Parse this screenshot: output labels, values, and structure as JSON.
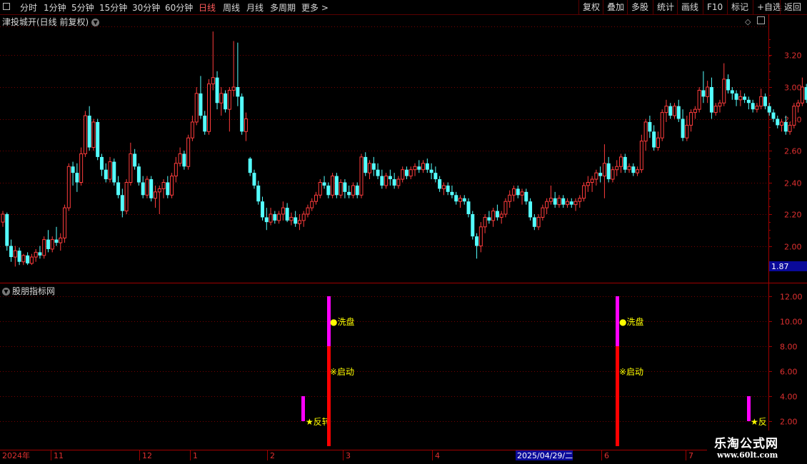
{
  "toolbar": {
    "periods": [
      "分时",
      "1分钟",
      "5分钟",
      "15分钟",
      "30分钟",
      "60分钟",
      "日线",
      "周线",
      "月线",
      "多周期",
      "更多 >"
    ],
    "active_period": "日线",
    "right_buttons": [
      "复权",
      "叠加",
      "多股",
      "统计",
      "画线",
      "F10",
      "标记",
      "+自选",
      "返回"
    ]
  },
  "stock": {
    "title": "津投城开(日线 前复权)",
    "chevron_icon": "chevron-down-icon"
  },
  "price_axis": {
    "ticks": [
      "3.20",
      "3.00",
      "2.80",
      "2.60",
      "2.40",
      "2.20",
      "2.00"
    ],
    "current_price": "1.87"
  },
  "indicator": {
    "title": "股朋指标网",
    "axis_ticks": [
      "12.00",
      "10.00",
      "8.00",
      "6.00",
      "4.00",
      "2.00"
    ],
    "signals": {
      "reversal": "★反转",
      "wash": "●洗盘",
      "start": "※启动",
      "reversal_cut": "★反"
    }
  },
  "time_axis": {
    "labels": [
      "2024年",
      "11",
      "12",
      "1",
      "2",
      "3",
      "4",
      "2025/04/29/二",
      "6",
      "7"
    ]
  },
  "watermark": {
    "line1": "乐淘公式网",
    "line2": "www.60lt.com"
  },
  "colors": {
    "up": "#ff3c3c",
    "down": "#54ffff",
    "grid": "#7a0000",
    "axis": "#a00000",
    "magenta": "#ff00ff",
    "red": "#ff0000",
    "signal": "#ffff00",
    "current_bg": "#0a0a9a"
  },
  "chart_data": {
    "type": "candlestick",
    "price_range": [
      1.87,
      3.35
    ],
    "candles": [
      [
        2.15,
        2.22,
        2.12,
        2.2
      ],
      [
        2.2,
        2.21,
        1.97,
        2.0
      ],
      [
        2.0,
        2.04,
        1.9,
        1.93
      ],
      [
        1.93,
        2.0,
        1.87,
        1.97
      ],
      [
        1.97,
        1.99,
        1.88,
        1.9
      ],
      [
        1.9,
        1.95,
        1.88,
        1.94
      ],
      [
        1.94,
        1.96,
        1.88,
        1.89
      ],
      [
        1.89,
        1.95,
        1.88,
        1.93
      ],
      [
        1.93,
        1.98,
        1.9,
        1.96
      ],
      [
        1.96,
        2.0,
        1.92,
        1.94
      ],
      [
        1.94,
        2.06,
        1.92,
        2.04
      ],
      [
        2.04,
        2.1,
        1.96,
        1.98
      ],
      [
        1.98,
        2.06,
        1.96,
        2.04
      ],
      [
        2.04,
        2.12,
        2.0,
        2.02
      ],
      [
        2.02,
        2.08,
        1.97,
        2.05
      ],
      [
        2.05,
        2.26,
        2.02,
        2.24
      ],
      [
        2.24,
        2.52,
        2.22,
        2.5
      ],
      [
        2.5,
        2.53,
        2.38,
        2.46
      ],
      [
        2.46,
        2.52,
        2.34,
        2.4
      ],
      [
        2.4,
        2.62,
        2.38,
        2.58
      ],
      [
        2.58,
        2.85,
        2.56,
        2.82
      ],
      [
        2.82,
        2.88,
        2.6,
        2.62
      ],
      [
        2.62,
        2.8,
        2.6,
        2.78
      ],
      [
        2.78,
        2.8,
        2.54,
        2.56
      ],
      [
        2.56,
        2.58,
        2.44,
        2.48
      ],
      [
        2.48,
        2.52,
        2.4,
        2.42
      ],
      [
        2.42,
        2.56,
        2.4,
        2.53
      ],
      [
        2.53,
        2.55,
        2.38,
        2.4
      ],
      [
        2.4,
        2.44,
        2.3,
        2.32
      ],
      [
        2.32,
        2.36,
        2.18,
        2.22
      ],
      [
        2.22,
        2.42,
        2.2,
        2.4
      ],
      [
        2.4,
        2.65,
        2.38,
        2.58
      ],
      [
        2.58,
        2.61,
        2.48,
        2.5
      ],
      [
        2.5,
        2.52,
        2.38,
        2.4
      ],
      [
        2.4,
        2.44,
        2.3,
        2.32
      ],
      [
        2.32,
        2.44,
        2.3,
        2.42
      ],
      [
        2.42,
        2.44,
        2.28,
        2.3
      ],
      [
        2.3,
        2.38,
        2.24,
        2.34
      ],
      [
        2.34,
        2.38,
        2.2,
        2.36
      ],
      [
        2.36,
        2.42,
        2.3,
        2.4
      ],
      [
        2.4,
        2.44,
        2.3,
        2.32
      ],
      [
        2.32,
        2.46,
        2.3,
        2.44
      ],
      [
        2.44,
        2.56,
        2.4,
        2.52
      ],
      [
        2.52,
        2.62,
        2.5,
        2.58
      ],
      [
        2.58,
        2.6,
        2.48,
        2.5
      ],
      [
        2.5,
        2.7,
        2.48,
        2.68
      ],
      [
        2.68,
        2.82,
        2.66,
        2.78
      ],
      [
        2.78,
        3.0,
        2.76,
        2.96
      ],
      [
        2.96,
        3.07,
        2.8,
        2.82
      ],
      [
        2.82,
        2.85,
        2.7,
        2.72
      ],
      [
        2.72,
        3.05,
        2.7,
        3.02
      ],
      [
        3.02,
        3.35,
        2.98,
        3.06
      ],
      [
        3.06,
        3.1,
        2.86,
        2.9
      ],
      [
        2.9,
        3.0,
        2.82,
        2.96
      ],
      [
        2.96,
        2.98,
        2.84,
        2.86
      ],
      [
        2.86,
        3.0,
        2.72,
        2.98
      ],
      [
        2.98,
        3.29,
        2.94,
        3.0
      ],
      [
        3.0,
        3.28,
        2.88,
        2.94
      ],
      [
        2.94,
        2.96,
        2.7,
        2.72
      ],
      [
        2.72,
        2.84,
        2.66,
        2.8
      ],
      [
        2.55,
        2.56,
        2.44,
        2.46
      ],
      [
        2.46,
        2.48,
        2.36,
        2.38
      ],
      [
        2.38,
        2.41,
        2.26,
        2.28
      ],
      [
        2.28,
        2.31,
        2.16,
        2.18
      ],
      [
        2.18,
        2.24,
        2.1,
        2.15
      ],
      [
        2.15,
        2.24,
        2.13,
        2.2
      ],
      [
        2.2,
        2.22,
        2.14,
        2.16
      ],
      [
        2.16,
        2.22,
        2.14,
        2.2
      ],
      [
        2.2,
        2.28,
        2.16,
        2.24
      ],
      [
        2.24,
        2.27,
        2.15,
        2.16
      ],
      [
        2.16,
        2.21,
        2.13,
        2.18
      ],
      [
        2.18,
        2.22,
        2.12,
        2.14
      ],
      [
        2.14,
        2.2,
        2.1,
        2.16
      ],
      [
        2.16,
        2.22,
        2.12,
        2.2
      ],
      [
        2.2,
        2.26,
        2.18,
        2.24
      ],
      [
        2.24,
        2.3,
        2.22,
        2.28
      ],
      [
        2.28,
        2.34,
        2.26,
        2.32
      ],
      [
        2.32,
        2.42,
        2.3,
        2.4
      ],
      [
        2.4,
        2.44,
        2.36,
        2.38
      ],
      [
        2.38,
        2.4,
        2.3,
        2.32
      ],
      [
        2.32,
        2.46,
        2.3,
        2.44
      ],
      [
        2.44,
        2.46,
        2.3,
        2.32
      ],
      [
        2.32,
        2.42,
        2.3,
        2.4
      ],
      [
        2.4,
        2.42,
        2.3,
        2.34
      ],
      [
        2.34,
        2.38,
        2.3,
        2.32
      ],
      [
        2.32,
        2.4,
        2.3,
        2.38
      ],
      [
        2.38,
        2.4,
        2.3,
        2.32
      ],
      [
        2.32,
        2.58,
        2.3,
        2.56
      ],
      [
        2.56,
        2.59,
        2.44,
        2.46
      ],
      [
        2.46,
        2.54,
        2.42,
        2.52
      ],
      [
        2.52,
        2.56,
        2.44,
        2.48
      ],
      [
        2.48,
        2.52,
        2.42,
        2.44
      ],
      [
        2.44,
        2.48,
        2.36,
        2.38
      ],
      [
        2.38,
        2.46,
        2.36,
        2.44
      ],
      [
        2.44,
        2.48,
        2.38,
        2.42
      ],
      [
        2.42,
        2.46,
        2.36,
        2.38
      ],
      [
        2.38,
        2.44,
        2.36,
        2.42
      ],
      [
        2.42,
        2.5,
        2.4,
        2.48
      ],
      [
        2.48,
        2.5,
        2.42,
        2.44
      ],
      [
        2.44,
        2.5,
        2.42,
        2.48
      ],
      [
        2.48,
        2.52,
        2.44,
        2.5
      ],
      [
        2.5,
        2.54,
        2.46,
        2.48
      ],
      [
        2.48,
        2.54,
        2.46,
        2.52
      ],
      [
        2.52,
        2.55,
        2.46,
        2.48
      ],
      [
        2.48,
        2.52,
        2.42,
        2.46
      ],
      [
        2.46,
        2.5,
        2.4,
        2.42
      ],
      [
        2.42,
        2.44,
        2.34,
        2.36
      ],
      [
        2.36,
        2.4,
        2.32,
        2.38
      ],
      [
        2.38,
        2.4,
        2.32,
        2.34
      ],
      [
        2.34,
        2.38,
        2.3,
        2.32
      ],
      [
        2.32,
        2.34,
        2.26,
        2.28
      ],
      [
        2.28,
        2.32,
        2.24,
        2.3
      ],
      [
        2.3,
        2.32,
        2.26,
        2.28
      ],
      [
        2.28,
        2.3,
        2.18,
        2.2
      ],
      [
        2.2,
        2.22,
        2.04,
        2.06
      ],
      [
        2.06,
        2.08,
        1.92,
        2.0
      ],
      [
        2.0,
        2.15,
        1.96,
        2.12
      ],
      [
        2.12,
        2.2,
        2.08,
        2.18
      ],
      [
        2.18,
        2.22,
        2.14,
        2.16
      ],
      [
        2.16,
        2.24,
        2.12,
        2.22
      ],
      [
        2.22,
        2.26,
        2.16,
        2.18
      ],
      [
        2.18,
        2.22,
        2.14,
        2.2
      ],
      [
        2.2,
        2.3,
        2.18,
        2.28
      ],
      [
        2.28,
        2.35,
        2.24,
        2.32
      ],
      [
        2.32,
        2.38,
        2.28,
        2.36
      ],
      [
        2.36,
        2.38,
        2.3,
        2.32
      ],
      [
        2.32,
        2.36,
        2.26,
        2.34
      ],
      [
        2.34,
        2.36,
        2.26,
        2.28
      ],
      [
        2.28,
        2.3,
        2.16,
        2.18
      ],
      [
        2.18,
        2.2,
        2.1,
        2.12
      ],
      [
        2.12,
        2.2,
        2.1,
        2.18
      ],
      [
        2.18,
        2.26,
        2.16,
        2.24
      ],
      [
        2.24,
        2.3,
        2.2,
        2.28
      ],
      [
        2.28,
        2.38,
        2.26,
        2.3
      ],
      [
        2.3,
        2.34,
        2.24,
        2.26
      ],
      [
        2.26,
        2.32,
        2.24,
        2.3
      ],
      [
        2.3,
        2.32,
        2.24,
        2.26
      ],
      [
        2.26,
        2.3,
        2.24,
        2.28
      ],
      [
        2.28,
        2.3,
        2.24,
        2.26
      ],
      [
        2.26,
        2.3,
        2.22,
        2.28
      ],
      [
        2.28,
        2.32,
        2.24,
        2.3
      ],
      [
        2.3,
        2.4,
        2.28,
        2.38
      ],
      [
        2.38,
        2.44,
        2.34,
        2.4
      ],
      [
        2.4,
        2.44,
        2.34,
        2.42
      ],
      [
        2.42,
        2.48,
        2.38,
        2.46
      ],
      [
        2.46,
        2.5,
        2.4,
        2.44
      ],
      [
        2.44,
        2.64,
        2.3,
        2.52
      ],
      [
        2.52,
        2.56,
        2.4,
        2.42
      ],
      [
        2.42,
        2.5,
        2.4,
        2.48
      ],
      [
        2.48,
        2.54,
        2.44,
        2.5
      ],
      [
        2.5,
        2.58,
        2.46,
        2.56
      ],
      [
        2.56,
        2.58,
        2.46,
        2.48
      ],
      [
        2.48,
        2.52,
        2.46,
        2.5
      ],
      [
        2.5,
        2.52,
        2.44,
        2.46
      ],
      [
        2.46,
        2.5,
        2.44,
        2.48
      ],
      [
        2.48,
        2.7,
        2.46,
        2.66
      ],
      [
        2.66,
        2.8,
        2.6,
        2.78
      ],
      [
        2.78,
        2.82,
        2.68,
        2.72
      ],
      [
        2.72,
        2.76,
        2.6,
        2.62
      ],
      [
        2.62,
        2.72,
        2.6,
        2.68
      ],
      [
        2.68,
        2.86,
        2.66,
        2.84
      ],
      [
        2.84,
        2.92,
        2.78,
        2.88
      ],
      [
        2.88,
        2.9,
        2.8,
        2.82
      ],
      [
        2.82,
        2.9,
        2.8,
        2.88
      ],
      [
        2.88,
        2.92,
        2.78,
        2.8
      ],
      [
        2.8,
        2.86,
        2.66,
        2.68
      ],
      [
        2.68,
        2.82,
        2.66,
        2.76
      ],
      [
        2.76,
        2.86,
        2.72,
        2.84
      ],
      [
        2.84,
        2.88,
        2.8,
        2.86
      ],
      [
        2.86,
        3.0,
        2.84,
        2.98
      ],
      [
        2.98,
        3.1,
        2.9,
        2.94
      ],
      [
        2.94,
        3.04,
        2.9,
        3.0
      ],
      [
        3.0,
        3.06,
        2.8,
        2.84
      ],
      [
        2.84,
        2.9,
        2.82,
        2.88
      ],
      [
        2.88,
        2.92,
        2.84,
        2.9
      ],
      [
        2.9,
        3.15,
        2.88,
        3.05
      ],
      [
        3.05,
        3.08,
        2.96,
        2.98
      ],
      [
        2.98,
        3.0,
        2.92,
        2.96
      ],
      [
        2.96,
        2.98,
        2.88,
        2.92
      ],
      [
        2.92,
        2.98,
        2.88,
        2.94
      ],
      [
        2.94,
        2.96,
        2.9,
        2.92
      ],
      [
        2.92,
        2.94,
        2.86,
        2.9
      ],
      [
        2.9,
        2.92,
        2.84,
        2.86
      ],
      [
        2.86,
        2.9,
        2.84,
        2.88
      ],
      [
        2.88,
        2.99,
        2.86,
        2.94
      ],
      [
        2.94,
        2.96,
        2.86,
        2.88
      ],
      [
        2.88,
        2.9,
        2.82,
        2.84
      ],
      [
        2.84,
        2.86,
        2.78,
        2.8
      ],
      [
        2.8,
        2.82,
        2.74,
        2.76
      ],
      [
        2.76,
        2.8,
        2.72,
        2.78
      ],
      [
        2.78,
        2.82,
        2.7,
        2.72
      ],
      [
        2.72,
        2.78,
        2.7,
        2.76
      ],
      [
        2.76,
        2.9,
        2.74,
        2.88
      ],
      [
        2.88,
        2.92,
        2.84,
        2.9
      ],
      [
        2.9,
        3.06,
        2.88,
        3.0
      ],
      [
        3.0,
        3.02,
        2.9,
        2.92
      ],
      [
        2.92,
        3.02,
        2.9,
        2.98
      ],
      [
        2.98,
        3.04,
        2.88,
        2.9
      ]
    ],
    "indicator_range": [
      0,
      12
    ],
    "indicator_bars": [
      {
        "date_label": "2",
        "segments": [
          {
            "from": 2,
            "to": 4,
            "color": "#ff00ff"
          }
        ],
        "label": "★反转"
      },
      {
        "date_label": "3",
        "segments": [
          {
            "from": 0,
            "to": 8,
            "color": "#ff0000"
          },
          {
            "from": 8,
            "to": 12,
            "color": "#ff00ff"
          }
        ],
        "label": "●洗盘 ※启动"
      },
      {
        "date_label": "6",
        "segments": [
          {
            "from": 0,
            "to": 8,
            "color": "#ff0000"
          },
          {
            "from": 8,
            "to": 12,
            "color": "#ff00ff"
          }
        ],
        "label": "●洗盘 ※启动"
      },
      {
        "date_label": "7",
        "segments": [
          {
            "from": 2,
            "to": 4,
            "color": "#ff00ff"
          }
        ],
        "label": "★反"
      }
    ]
  }
}
